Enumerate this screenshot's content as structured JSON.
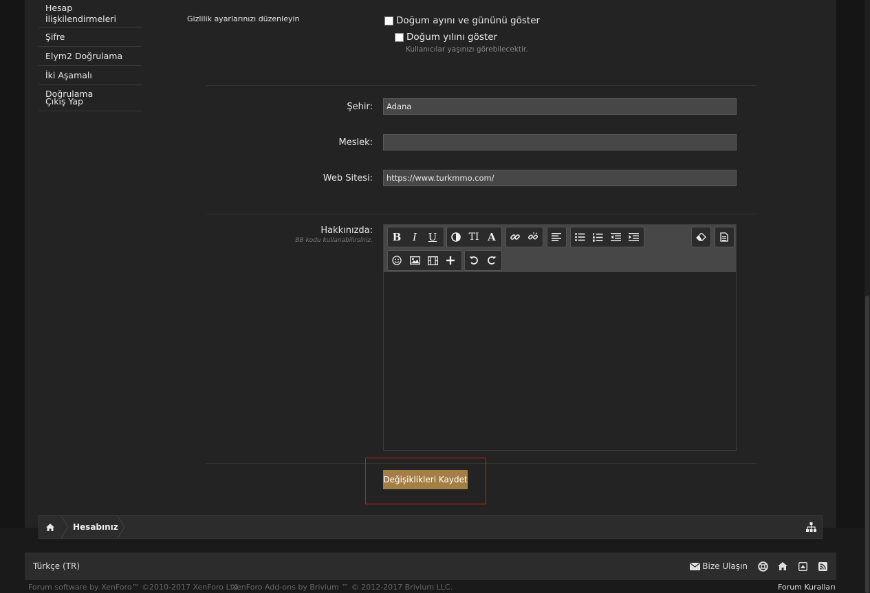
{
  "sidebar": {
    "items": [
      {
        "label": "Hesap İlişkilendirmeleri"
      },
      {
        "label": "Şifre"
      },
      {
        "label": "Elym2 Doğrulama"
      },
      {
        "label": "İki Aşamalı Doğrulama"
      },
      {
        "label": "Çıkış Yap"
      }
    ]
  },
  "privacy": {
    "label": "Gizlilik ayarlarınızı düzenleyin",
    "show_day_month": "Doğum ayını ve gününü göster",
    "show_year": "Doğum yılını göster",
    "year_hint": "Kullanıcılar yaşınızı görebilecektir."
  },
  "fields": {
    "city_label": "Şehir:",
    "city_value": "Adana",
    "occupation_label": "Meslek:",
    "occupation_value": "",
    "website_label": "Web Sitesi:",
    "website_value": "https://www.turkmmo.com/"
  },
  "about": {
    "label": "Hakkınızda:",
    "hint": "BB kodu kullanabilirsiniz.",
    "content": ""
  },
  "toolbar": {
    "bold": "B",
    "italic": "I",
    "underline": "U",
    "font_size": "TI",
    "font_color": "A",
    "icons": [
      "bold-icon",
      "italic-icon",
      "underline-icon",
      "color-contrast-icon",
      "font-size-icon",
      "font-color-icon",
      "link-icon",
      "unlink-icon",
      "align-left-icon",
      "bullet-list-icon",
      "numbered-list-icon",
      "outdent-icon",
      "indent-icon",
      "eraser-icon",
      "source-view-icon",
      "smiley-icon",
      "image-icon",
      "media-icon",
      "plus-icon",
      "undo-icon",
      "redo-icon"
    ]
  },
  "actions": {
    "save_label": "Değişiklikleri Kaydet",
    "highlight_color": "#d01c1c",
    "accent_color": "#a47f45"
  },
  "breadcrumb": {
    "items": [
      "Hesabınız"
    ]
  },
  "footer": {
    "language": "Türkçe (TR)",
    "contact": "Bize Ulaşın",
    "copyright_xenforo": "Forum software by XenForo™ ©2010-2017 XenForo Ltd.",
    "copyright_brivium": "XenForo Add-ons by Brivium ™ © 2012-2017 Brivium LLC.",
    "rules": "Forum Kuralları"
  }
}
